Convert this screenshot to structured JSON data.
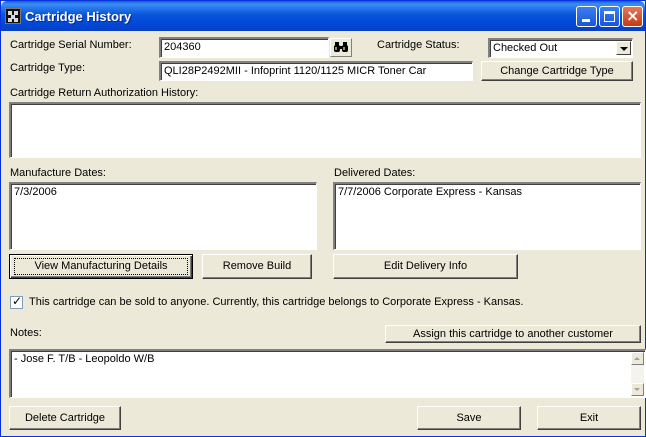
{
  "window": {
    "title": "Cartridge History"
  },
  "serial": {
    "label": "Cartridge Serial Number:",
    "value": "204360"
  },
  "status": {
    "label": "Cartridge Status:",
    "value": "Checked Out"
  },
  "type": {
    "label": "Cartridge Type:",
    "value": "QLI28P2492MII - Infoprint 1120/1125 MICR Toner Car",
    "button": "Change Cartridge Type"
  },
  "return_history": {
    "label": "Cartridge Return Authorization History:",
    "value": ""
  },
  "manufacture": {
    "label": "Manufacture Dates:",
    "items": [
      "7/3/2006"
    ]
  },
  "delivered": {
    "label": "Delivered Dates:",
    "items": [
      "7/7/2006  Corporate Express - Kansas"
    ]
  },
  "buttons": {
    "view_details": "View Manufacturing Details",
    "remove_build": "Remove Build",
    "edit_delivery": "Edit Delivery Info",
    "assign": "Assign this cartridge to another customer",
    "delete": "Delete Cartridge",
    "save": "Save",
    "exit": "Exit"
  },
  "sellable": {
    "checked": true,
    "text": "This cartridge can be sold to anyone.  Currently, this cartridge belongs to Corporate Express - Kansas."
  },
  "notes": {
    "label": "Notes:",
    "value": " - Jose F. T/B -  Leopoldo W/B"
  },
  "icons": {
    "search": "binoculars-icon",
    "window": "app-icon"
  }
}
